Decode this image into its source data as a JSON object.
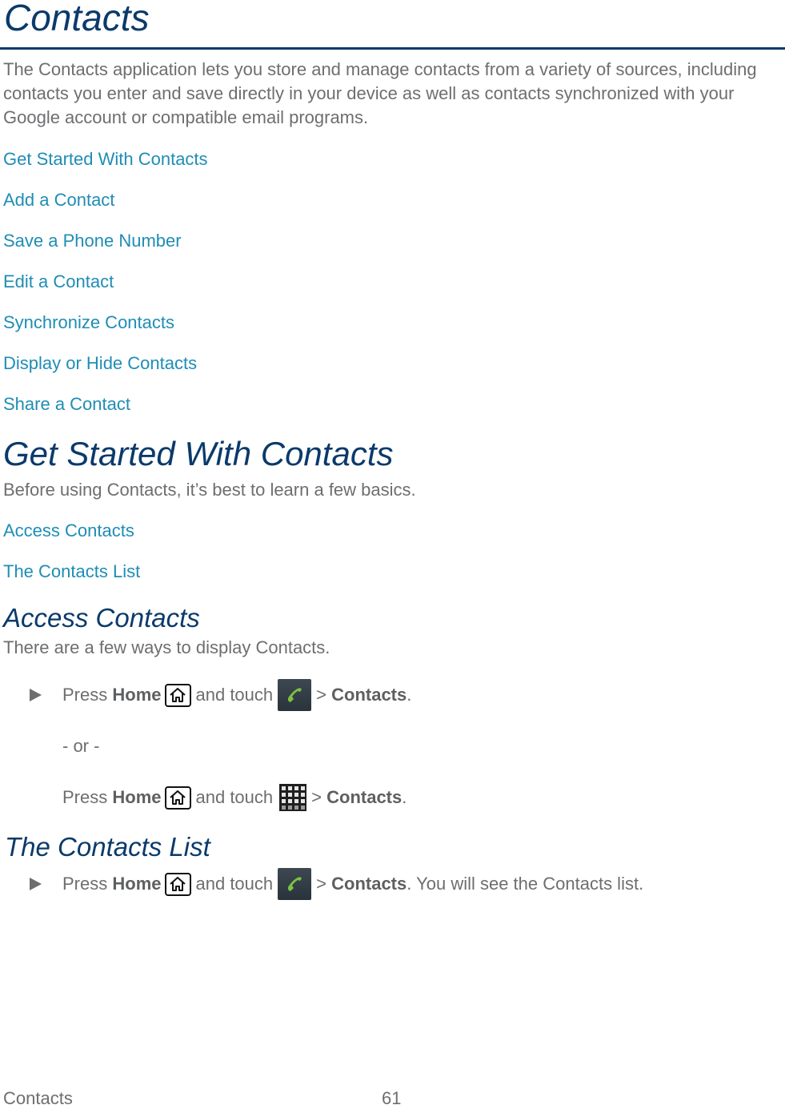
{
  "page": {
    "title": "Contacts",
    "intro": "The Contacts application lets you store and manage contacts from a variety of sources, including contacts you enter and save directly in your device as well as contacts synchronized with your Google account or compatible email programs.",
    "toc_links": [
      "Get Started With Contacts",
      "Add a Contact",
      "Save a Phone Number",
      "Edit a Contact",
      "Synchronize Contacts",
      "Display or Hide Contacts",
      "Share a Contact"
    ]
  },
  "get_started": {
    "heading": "Get Started With Contacts",
    "intro": "Before using Contacts, it’s best to learn a few basics.",
    "links": [
      "Access Contacts",
      "The Contacts List"
    ]
  },
  "access_contacts": {
    "heading": "Access Contacts",
    "intro": "There are a few ways to display Contacts.",
    "step1": {
      "press": "Press",
      "home": "Home",
      "and_touch": "and touch",
      "sep": ">",
      "target": "Contacts",
      "end": "."
    },
    "or_text": "- or -",
    "step2": {
      "press": "Press",
      "home": "Home",
      "and_touch": "and touch",
      "sep": ">",
      "target": "Contacts",
      "end": "."
    }
  },
  "contacts_list": {
    "heading": "The Contacts List",
    "step": {
      "press": "Press",
      "home": "Home",
      "and_touch": "and touch",
      "sep": ">",
      "target": "Contacts",
      "end": ". You will see the Contacts list."
    }
  },
  "icons": {
    "bullet": "right-triangle-bullet",
    "home": "home-key-icon",
    "phone": "phone-app-icon",
    "apps": "apps-grid-icon"
  },
  "colors": {
    "heading": "#0b3a6b",
    "link": "#1f8db5",
    "body": "#6d6e70"
  },
  "footer": {
    "section": "Contacts",
    "page_number": "61"
  }
}
